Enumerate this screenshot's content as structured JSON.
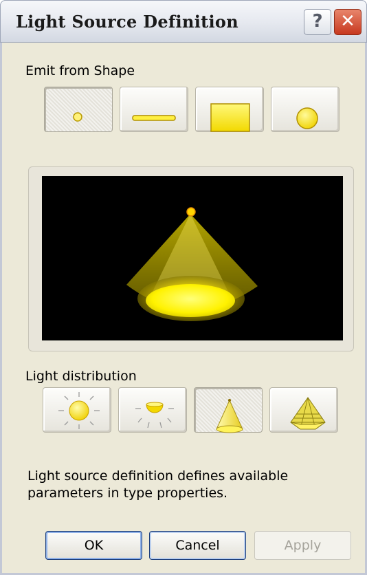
{
  "window": {
    "title": "Light Source Definition",
    "help_label": "?",
    "close_label": "✕"
  },
  "emit": {
    "label": "Emit from Shape",
    "options": [
      {
        "icon": "point-shape-icon",
        "selected": true
      },
      {
        "icon": "line-shape-icon",
        "selected": false
      },
      {
        "icon": "rectangle-shape-icon",
        "selected": false
      },
      {
        "icon": "circle-shape-icon",
        "selected": false
      }
    ]
  },
  "preview": {
    "icon": "spot-cone-preview"
  },
  "distribution": {
    "label": "Light distribution",
    "options": [
      {
        "icon": "spherical-distribution-icon",
        "selected": false
      },
      {
        "icon": "hemispherical-distribution-icon",
        "selected": false
      },
      {
        "icon": "spot-distribution-icon",
        "selected": true
      },
      {
        "icon": "photometric-web-distribution-icon",
        "selected": false
      }
    ]
  },
  "description": "Light source definition defines available parameters in type properties.",
  "buttons": {
    "ok": "OK",
    "cancel": "Cancel",
    "apply": "Apply"
  },
  "colors": {
    "light_yellow": "#ffee33",
    "dialog_bg": "#ece9d8",
    "preview_bg": "#000000"
  }
}
